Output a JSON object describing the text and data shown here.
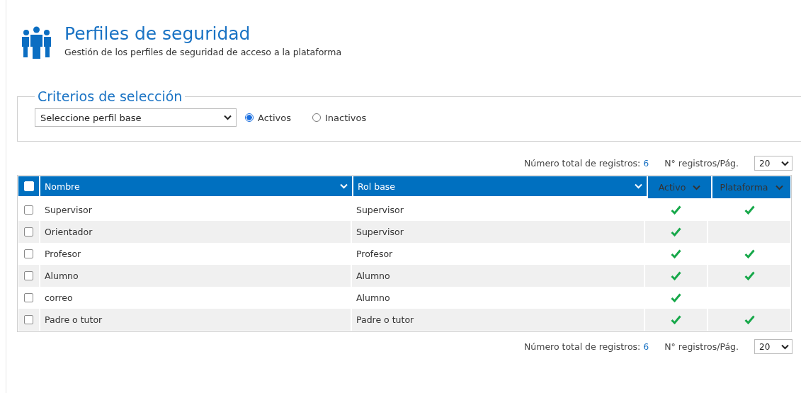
{
  "header": {
    "title": "Perfiles de seguridad",
    "subtitle": "Gestión de los perfiles de seguridad de acceso a la plataforma"
  },
  "criteria": {
    "legend": "Criterios de selección",
    "profile_select": {
      "value": "Seleccione perfil base"
    },
    "status_options": [
      {
        "label": "Activos",
        "selected": true
      },
      {
        "label": "Inactivos",
        "selected": false
      }
    ]
  },
  "pager_top": {
    "total_label": "Número total de registros:",
    "total": "6",
    "per_page_label": "N° registros/Pág.",
    "per_page": "20"
  },
  "table": {
    "select_all_checked": false,
    "columns": [
      {
        "label": "Nombre",
        "kind": "text"
      },
      {
        "label": "Rol base",
        "kind": "text"
      },
      {
        "label": "Activo",
        "kind": "check"
      },
      {
        "label": "Plataforma",
        "kind": "check"
      }
    ],
    "rows": [
      {
        "checked": false,
        "cells": [
          "Supervisor",
          "Supervisor",
          true,
          true
        ]
      },
      {
        "checked": false,
        "cells": [
          "Orientador",
          "Supervisor",
          true,
          false
        ]
      },
      {
        "checked": false,
        "cells": [
          "Profesor",
          "Profesor",
          true,
          true
        ]
      },
      {
        "checked": false,
        "cells": [
          "Alumno",
          "Alumno",
          true,
          true
        ]
      },
      {
        "checked": false,
        "cells": [
          "correo",
          "Alumno",
          true,
          false
        ]
      },
      {
        "checked": false,
        "cells": [
          "Padre o tutor",
          "Padre o tutor",
          true,
          true
        ]
      }
    ]
  },
  "pager_bottom": {
    "total_label": "Número total de registros:",
    "total": "6",
    "per_page_label": "N° registros/Pág.",
    "per_page": "20"
  }
}
